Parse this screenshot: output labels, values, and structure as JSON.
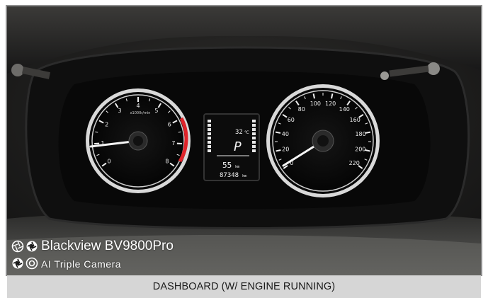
{
  "photo": {
    "subject": "car instrument cluster",
    "tachometer": {
      "scale_labels": [
        "0",
        "1",
        "2",
        "3",
        "4",
        "5",
        "6",
        "7",
        "8"
      ],
      "unit_label": "x1000r/min",
      "needle_value": 0.8,
      "redline_start": 6.3
    },
    "speedometer": {
      "scale_labels": [
        "0",
        "20",
        "40",
        "60",
        "80",
        "100",
        "120",
        "140",
        "160",
        "180",
        "200",
        "220"
      ],
      "needle_value": 0
    },
    "lcd": {
      "top_value": "32",
      "top_unit": "℃",
      "gear": "P",
      "range_value": "55",
      "range_unit": "km",
      "odometer": "87348",
      "odometer_unit": "km"
    }
  },
  "watermark": {
    "brand": "Blackview BV9800Pro",
    "subtitle": "AI Triple Camera",
    "icons": [
      "aperture-icon",
      "aperture-icon",
      "aperture-icon",
      "camera-lens-icon"
    ]
  },
  "caption": "DASHBOARD (W/ ENGINE RUNNING)",
  "colors": {
    "caption_bg": "#d6d6d6",
    "frame": "#8f8f8f",
    "dash": "#1a1919",
    "gauge_ring": "#e9e9e9",
    "redline": "#e0242a"
  }
}
